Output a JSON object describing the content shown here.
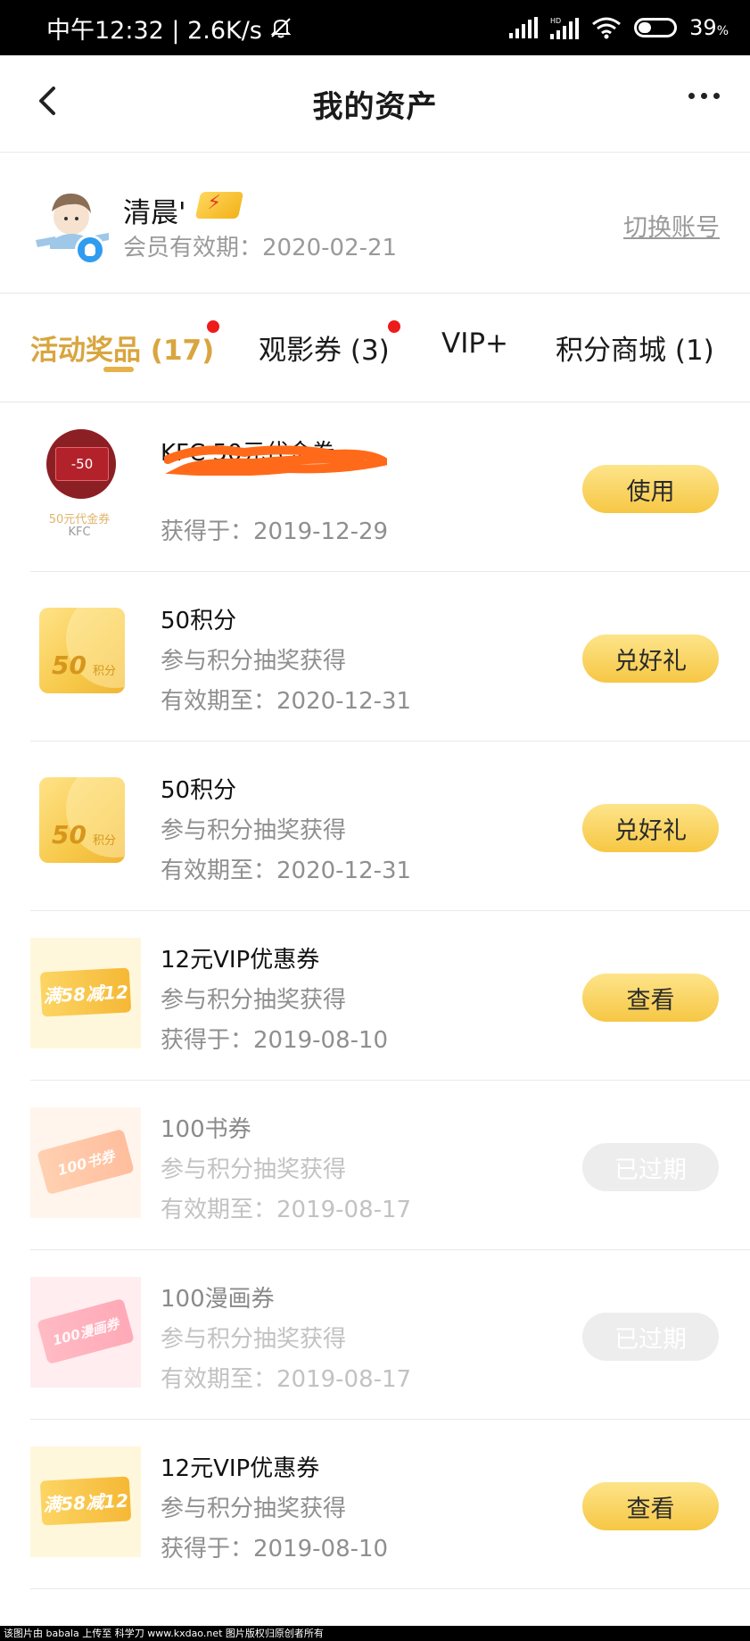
{
  "status_bar": {
    "time": "中午12:32 | 2.6K/s",
    "battery": "39",
    "battery_unit": "%"
  },
  "header": {
    "title": "我的资产"
  },
  "profile": {
    "username": "清晨'",
    "expiry": "会员有效期：2020-02-21",
    "switch_label": "切换账号"
  },
  "tabs": [
    {
      "label": "活动奖品 (17)",
      "active": true,
      "dot": true
    },
    {
      "label": "观影券 (3)",
      "active": false,
      "dot": true
    },
    {
      "label": "VIP+",
      "active": false,
      "dot": false
    },
    {
      "label": "积分商城 (1)",
      "active": false,
      "dot": false
    }
  ],
  "items": [
    {
      "title": "KFC 50元代金券",
      "sub1": "",
      "sub2": "获得于：2019-12-29",
      "button": "使用",
      "expired": false,
      "thumb_top": "50元代金券",
      "thumb_bottom": "KFC",
      "thumb_card": "-50"
    },
    {
      "title": "50积分",
      "sub1": "参与积分抽奖获得",
      "sub2": "有效期至：2020-12-31",
      "button": "兑好礼",
      "expired": false,
      "thumb_main": "50",
      "thumb_sub": "积分"
    },
    {
      "title": "50积分",
      "sub1": "参与积分抽奖获得",
      "sub2": "有效期至：2020-12-31",
      "button": "兑好礼",
      "expired": false,
      "thumb_main": "50",
      "thumb_sub": "积分"
    },
    {
      "title": "12元VIP优惠券",
      "sub1": "参与积分抽奖获得",
      "sub2": "获得于：2019-08-10",
      "button": "查看",
      "expired": false,
      "thumb_text": "满58减12"
    },
    {
      "title": "100书券",
      "sub1": "参与积分抽奖获得",
      "sub2": "有效期至：2019-08-17",
      "button": "已过期",
      "expired": true,
      "thumb_text": "100书券"
    },
    {
      "title": "100漫画券",
      "sub1": "参与积分抽奖获得",
      "sub2": "有效期至：2019-08-17",
      "button": "已过期",
      "expired": true,
      "thumb_text": "100漫画券"
    },
    {
      "title": "12元VIP优惠券",
      "sub1": "参与积分抽奖获得",
      "sub2": "获得于：2019-08-10",
      "button": "查看",
      "expired": false,
      "thumb_text": "满58减12"
    }
  ],
  "footer": {
    "text": "该图片由 babala 上传至 科学刀 www.kxdao.net 图片版权归原创者所有"
  },
  "colors": {
    "accent": "#d9a53e",
    "button": "#f6c744",
    "dot": "#ee1b1b"
  }
}
